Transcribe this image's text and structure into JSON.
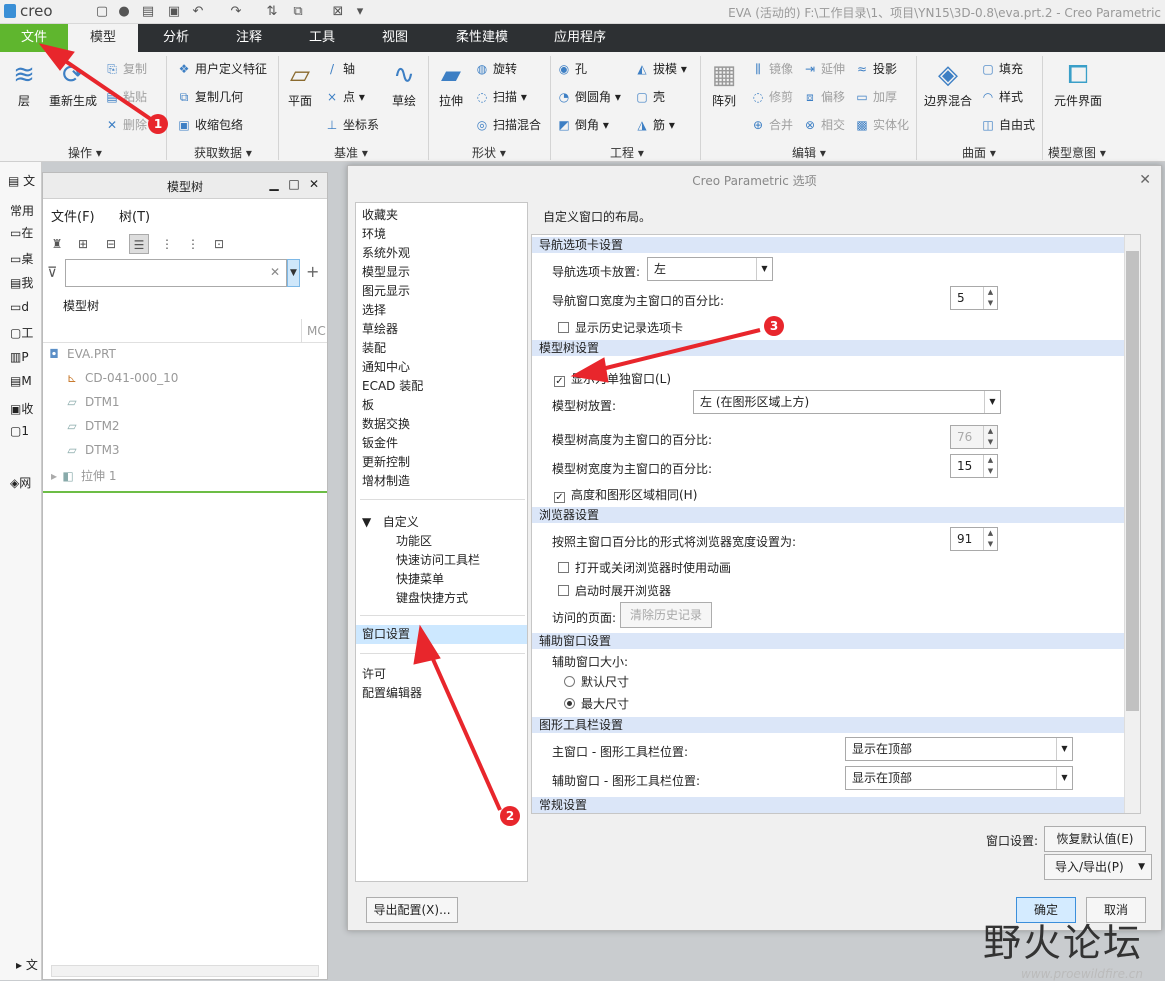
{
  "app": {
    "logo": "creo",
    "window_title": "EVA (活动的) F:\\工作目录\\1、项目\\YN15\\3D-0.8\\eva.prt.2 - Creo Parametric"
  },
  "tabs": [
    "文件",
    "模型",
    "分析",
    "注释",
    "工具",
    "视图",
    "柔性建模",
    "应用程序"
  ],
  "ribbon": {
    "operations": {
      "layer": "层",
      "regenerate": "重新生成",
      "copy": "复制",
      "paste": "粘贴",
      "delete": "删除",
      "group": "操作"
    },
    "get_data": {
      "udf": "用户定义特征",
      "copy_geom": "复制几何",
      "shrinkwrap": "收缩包络",
      "group": "获取数据"
    },
    "datum": {
      "plane": "平面",
      "axis": "轴",
      "point": "点",
      "csys": "坐标系",
      "sketch": "草绘",
      "group": "基准"
    },
    "shapes": {
      "extrude": "拉伸",
      "revolve": "旋转",
      "sweep": "扫描",
      "swept_blend": "扫描混合",
      "group": "形状"
    },
    "engineering": {
      "hole": "孔",
      "round": "倒圆角",
      "chamfer": "倒角",
      "draft": "拔模",
      "shell": "壳",
      "rib": "筋",
      "group": "工程"
    },
    "editing": {
      "pattern": "阵列",
      "mirror": "镜像",
      "extend": "延伸",
      "project": "投影",
      "trim": "修剪",
      "offset": "偏移",
      "thicken": "加厚",
      "merge": "合并",
      "intersect": "相交",
      "solidify": "实体化",
      "group": "编辑"
    },
    "surfaces": {
      "boundary_blend": "边界混合",
      "fill": "填充",
      "style": "样式",
      "freestyle": "自由式",
      "group": "曲面"
    },
    "model_intent": {
      "component_interface": "元件界面",
      "group": "模型意图"
    }
  },
  "leftbar": [
    "文",
    "常用",
    "在",
    "桌",
    "我",
    "d",
    "工",
    "P",
    "M",
    "收",
    "1",
    "网",
    "文"
  ],
  "model_tree": {
    "title": "模型树",
    "menu_file": "文件(F)",
    "menu_tree": "树(T)",
    "label": "模型树",
    "col": "MC",
    "nodes": [
      "EVA.PRT",
      "CD-041-000_10",
      "DTM1",
      "DTM2",
      "DTM3",
      "拉伸 1"
    ]
  },
  "dialog": {
    "title": "Creo Parametric 选项",
    "description": "自定义窗口的布局。",
    "nav": [
      "收藏夹",
      "环境",
      "系统外观",
      "模型显示",
      "图元显示",
      "选择",
      "草绘器",
      "装配",
      "通知中心",
      "ECAD 装配",
      "板",
      "数据交换",
      "钣金件",
      "更新控制",
      "增材制造"
    ],
    "nav_custom": "自定义",
    "nav_custom_sub": [
      "功能区",
      "快速访问工具栏",
      "快捷菜单",
      "键盘快捷方式"
    ],
    "nav_window": "窗口设置",
    "nav_bottom": [
      "许可",
      "配置编辑器"
    ],
    "sections": {
      "navigator": {
        "title": "导航选项卡设置",
        "placement_label": "导航选项卡放置:",
        "placement_value": "左",
        "width_label": "导航窗口宽度为主窗口的百分比:",
        "width_value": "5",
        "history_label": "显示历史记录选项卡"
      },
      "model_tree": {
        "title": "模型树设置",
        "separate_label": "显示为单独窗口(L)",
        "placement_label": "模型树放置:",
        "placement_value": "左 (在图形区域上方)",
        "height_label": "模型树高度为主窗口的百分比:",
        "height_value": "76",
        "width_label": "模型树宽度为主窗口的百分比:",
        "width_value": "15",
        "same_height_label": "高度和图形区域相同(H)"
      },
      "browser": {
        "title": "浏览器设置",
        "width_label": "按照主窗口百分比的形式将浏览器宽度设置为:",
        "width_value": "91",
        "animate_label": "打开或关闭浏览器时使用动画",
        "expand_label": "启动时展开浏览器",
        "visited_label": "访问的页面:",
        "clear_label": "清除历史记录"
      },
      "aux": {
        "title": "辅助窗口设置",
        "size_label": "辅助窗口大小:",
        "default_label": "默认尺寸",
        "max_label": "最大尺寸"
      },
      "graphics": {
        "title": "图形工具栏设置",
        "main_label": "主窗口 - 图形工具栏位置:",
        "main_value": "显示在顶部",
        "aux_label": "辅助窗口 - 图形工具栏位置:",
        "aux_value": "显示在顶部"
      },
      "general": {
        "title": "常规设置"
      }
    },
    "window_settings_label": "窗口设置:",
    "restore_label": "恢复默认值(E)",
    "import_export_label": "导入/导出(P)",
    "export_config_label": "导出配置(X)...",
    "ok_label": "确定",
    "cancel_label": "取消"
  },
  "annotations": [
    "1",
    "2",
    "3"
  ],
  "watermark": {
    "text": "野火论坛",
    "url": "www.proewildfire.cn"
  },
  "colors": {
    "file_tab": "#5fb62e",
    "tab_bar": "#2d3033",
    "arrow": "#e8262c",
    "section": "#dbe6f8",
    "selection": "#cde8ff"
  }
}
